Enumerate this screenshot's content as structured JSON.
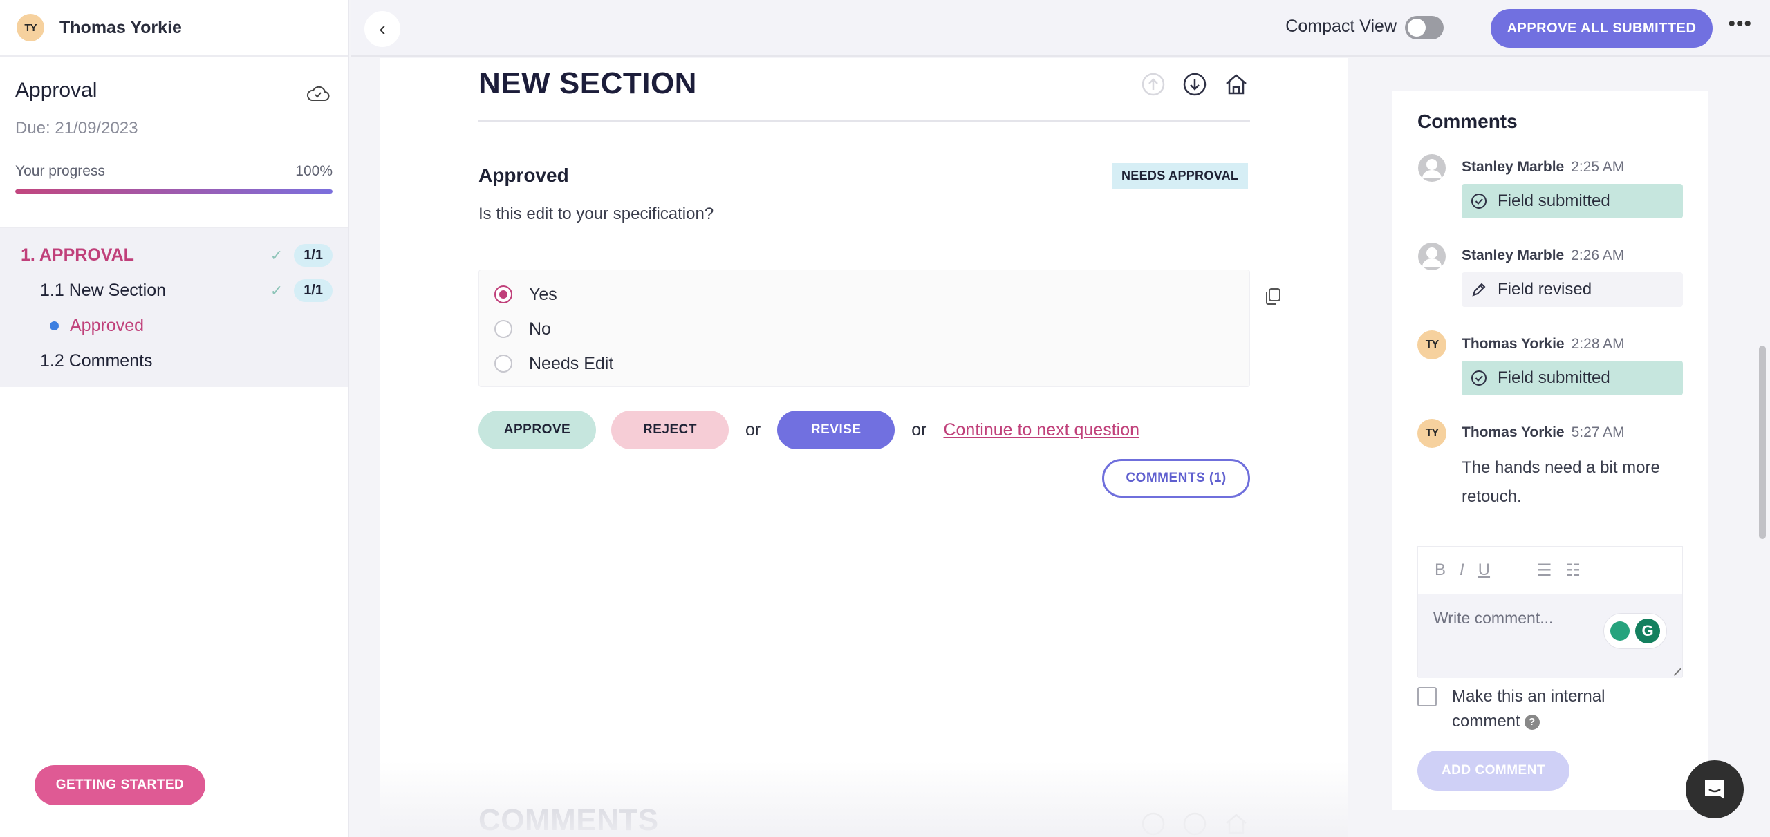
{
  "user": {
    "initials": "TY",
    "name": "Thomas Yorkie"
  },
  "sidebar": {
    "project_title": "Approval",
    "due": "Due: 21/09/2023",
    "progress_label": "Your progress",
    "progress_text": "100%",
    "progress_value": 1.0,
    "nav": [
      {
        "label": "1. APPROVAL",
        "count": "1/1",
        "level": 1,
        "complete": true
      },
      {
        "label": "1.1 New Section",
        "count": "1/1",
        "level": 2,
        "complete": true
      },
      {
        "label": "Approved",
        "level": 3,
        "active": true
      },
      {
        "label": "1.2 Comments",
        "level": 2
      }
    ],
    "getting_started": "GETTING STARTED"
  },
  "header": {
    "compact_view_label": "Compact View",
    "compact_view_on": false,
    "approve_all": "APPROVE ALL SUBMITTED",
    "more": "•••"
  },
  "main": {
    "section_title": "NEW SECTION",
    "question": {
      "title": "Approved",
      "badge": "NEEDS APPROVAL",
      "text": "Is this edit to your specification?",
      "options": [
        {
          "label": "Yes",
          "selected": true
        },
        {
          "label": "No",
          "selected": false
        },
        {
          "label": "Needs Edit",
          "selected": false
        }
      ]
    },
    "actions": {
      "approve": "APPROVE",
      "reject": "REJECT",
      "or1": "or",
      "revise": "REVISE",
      "or2": "or",
      "continue": "Continue to next question",
      "comments": "COMMENTS (1)"
    },
    "next_section_title": "COMMENTS"
  },
  "comments": {
    "title": "Comments",
    "items": [
      {
        "author": "Stanley Marble",
        "time": "2:25 AM",
        "avatar": "default",
        "status": "Field submitted",
        "status_icon": "check-circle"
      },
      {
        "author": "Stanley Marble",
        "time": "2:26 AM",
        "avatar": "default",
        "status": "Field revised",
        "status_icon": "pencil"
      },
      {
        "author": "Thomas Yorkie",
        "time": "2:28 AM",
        "avatar": "TY",
        "status": "Field submitted",
        "status_icon": "check-circle"
      },
      {
        "author": "Thomas Yorkie",
        "time": "5:27 AM",
        "avatar": "TY",
        "text": "The hands need a bit more retouch."
      }
    ],
    "editor": {
      "toolbar": [
        "B",
        "I",
        "U",
        "bullet-list",
        "numbered-list"
      ],
      "placeholder": "Write comment...",
      "grammarly_letter": "G"
    },
    "internal_label": "Make this an internal comment",
    "internal_checked": false,
    "help": "?",
    "add_comment": "ADD COMMENT"
  },
  "colors": {
    "accent_purple": "#7170e0",
    "accent_pink": "#c0407a",
    "approve_green": "#c6e6de",
    "reject_pink": "#f6cdd6",
    "getting_started": "#df5a94"
  }
}
